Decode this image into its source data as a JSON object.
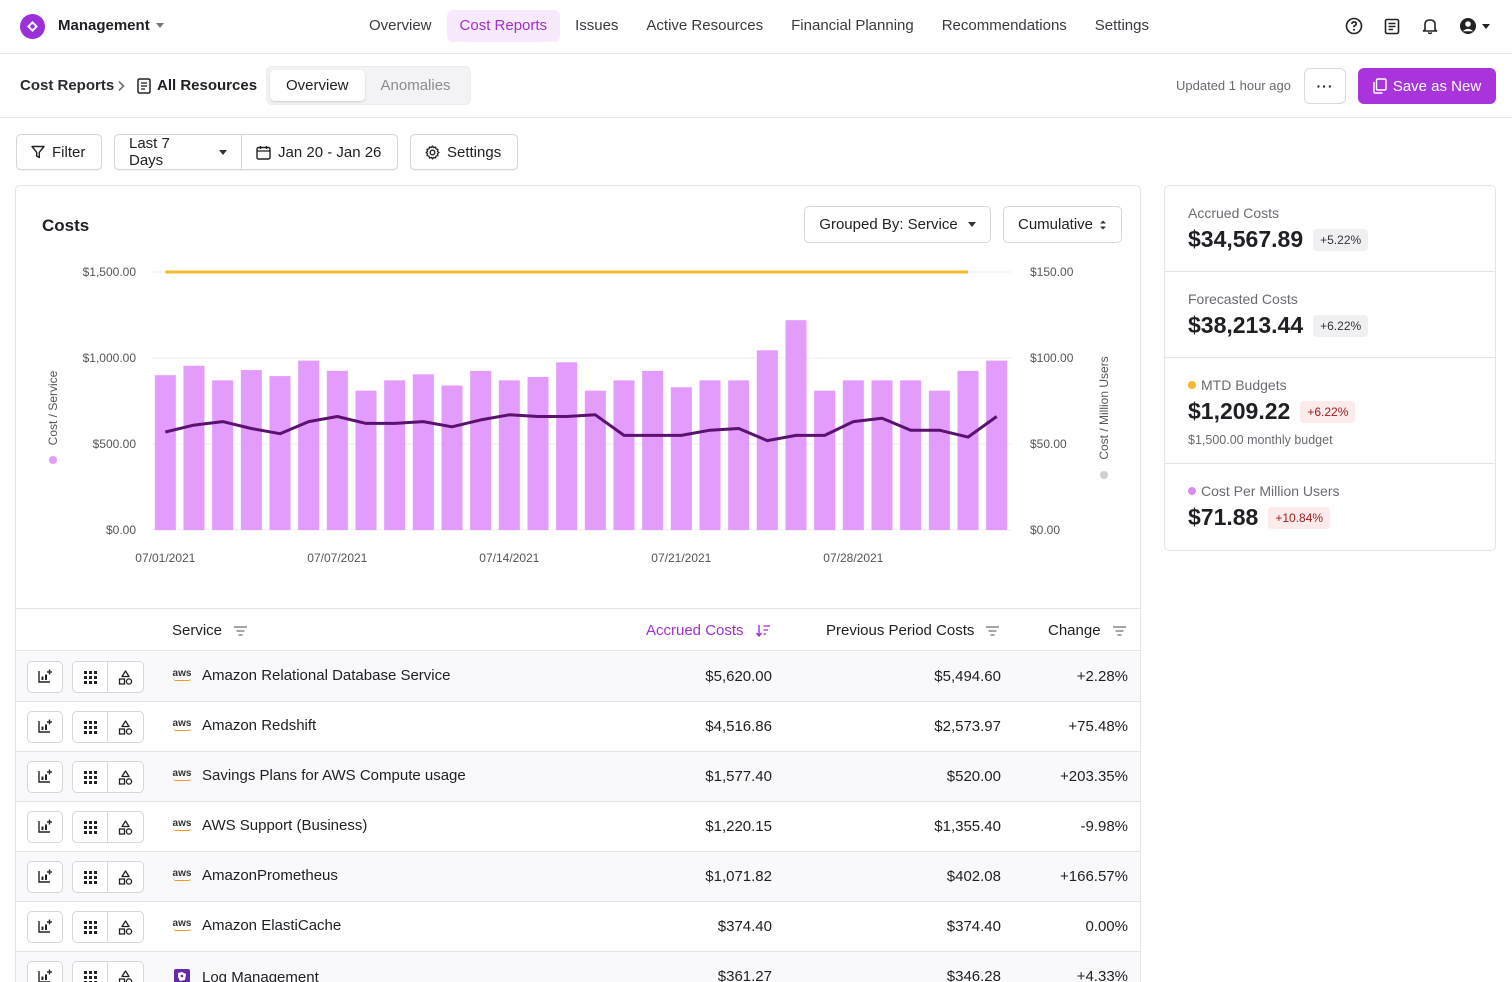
{
  "nav": {
    "workspace": "Management",
    "links": [
      "Overview",
      "Cost Reports",
      "Issues",
      "Active Resources",
      "Financial Planning",
      "Recommendations",
      "Settings"
    ],
    "active_index": 1,
    "icons": [
      "help-icon",
      "docs-icon",
      "bell-icon",
      "user-icon"
    ]
  },
  "subheader": {
    "breadcrumb_root": "Cost Reports",
    "breadcrumb_current": "All Resources",
    "tabs": [
      "Overview",
      "Anomalies"
    ],
    "updated": "Updated 1 hour ago",
    "more_label": "···",
    "save_label": "Save as New"
  },
  "filters": {
    "filter_label": "Filter",
    "range_label": "Last 7 Days",
    "date_label": "Jan 20 - Jan 26",
    "settings_label": "Settings"
  },
  "chart_panel": {
    "title": "Costs",
    "group_label": "Grouped By: Service",
    "mode_label": "Cumulative"
  },
  "chart_data": {
    "type": "bar",
    "ylabel": "Cost / Service",
    "y2label": "Cost / Million Users",
    "y_ticks": [
      "$1,500.00",
      "$1,000.00",
      "$500.00",
      "$0.00"
    ],
    "y2_ticks": [
      "$150.00",
      "$100.00",
      "$50.00",
      "$0.00"
    ],
    "ylim": [
      0,
      1500
    ],
    "y2lim": [
      0,
      150
    ],
    "x_tick_labels": [
      "07/01/2021",
      "07/07/2021",
      "07/14/2021",
      "07/21/2021",
      "07/28/2021"
    ],
    "x_tick_indices": [
      0,
      6,
      12,
      18,
      24
    ],
    "budget_line": 1500,
    "bars": [
      900,
      955,
      870,
      930,
      895,
      985,
      925,
      810,
      870,
      905,
      840,
      925,
      870,
      890,
      975,
      810,
      870,
      925,
      830,
      870,
      870,
      1045,
      1220,
      810,
      870,
      870,
      870,
      810,
      925,
      985
    ],
    "line": [
      57,
      61,
      63,
      59,
      56,
      63,
      66,
      62,
      62,
      63,
      60,
      64,
      67,
      66,
      66,
      67,
      55,
      55,
      55,
      58,
      59,
      52,
      55,
      55,
      63,
      65,
      58,
      58,
      54,
      66
    ],
    "bar_color": "#e39cfb",
    "line_color": "#5a1170",
    "budget_color": "#f2b92b"
  },
  "table": {
    "headers": {
      "service": "Service",
      "accrued": "Accrued Costs",
      "previous": "Previous Period Costs",
      "change": "Change"
    },
    "rows": [
      {
        "icon": "aws-logo-icon",
        "service": "Amazon Relational Database Service",
        "accrued": "$5,620.00",
        "previous": "$5,494.60",
        "change": "+2.28%"
      },
      {
        "icon": "aws-logo-icon",
        "service": "Amazon Redshift",
        "accrued": "$4,516.86",
        "previous": "$2,573.97",
        "change": "+75.48%"
      },
      {
        "icon": "aws-logo-icon",
        "service": "Savings Plans for AWS Compute usage",
        "accrued": "$1,577.40",
        "previous": "$520.00",
        "change": "+203.35%"
      },
      {
        "icon": "aws-logo-icon",
        "service": "AWS Support (Business)",
        "accrued": "$1,220.15",
        "previous": "$1,355.40",
        "change": "-9.98%"
      },
      {
        "icon": "aws-logo-icon",
        "service": "AmazonPrometheus",
        "accrued": "$1,071.82",
        "previous": "$402.08",
        "change": "+166.57%"
      },
      {
        "icon": "aws-logo-icon",
        "service": "Amazon ElastiCache",
        "accrued": "$374.40",
        "previous": "$374.40",
        "change": "0.00%"
      },
      {
        "icon": "datadog-logo-icon",
        "service": "Log Management",
        "accrued": "$361.27",
        "previous": "$346.28",
        "change": "+4.33%"
      }
    ]
  },
  "cards": [
    {
      "label": "Accrued Costs",
      "value": "$34,567.89",
      "delta": "+5.22%",
      "delta_tone": "neutral",
      "dot": null,
      "sub": null
    },
    {
      "label": "Forecasted Costs",
      "value": "$38,213.44",
      "delta": "+6.22%",
      "delta_tone": "neutral",
      "dot": null,
      "sub": null
    },
    {
      "label": "MTD Budgets",
      "value": "$1,209.22",
      "delta": "+6.22%",
      "delta_tone": "red",
      "dot": "#f2b92b",
      "sub": "$1,500.00 monthly budget"
    },
    {
      "label": "Cost Per Million Users",
      "value": "$71.88",
      "delta": "+10.84%",
      "delta_tone": "red",
      "dot": "#d98cf0",
      "sub": null
    }
  ],
  "colors": {
    "accent": "#a934db",
    "accent_text": "#a32fd0"
  }
}
